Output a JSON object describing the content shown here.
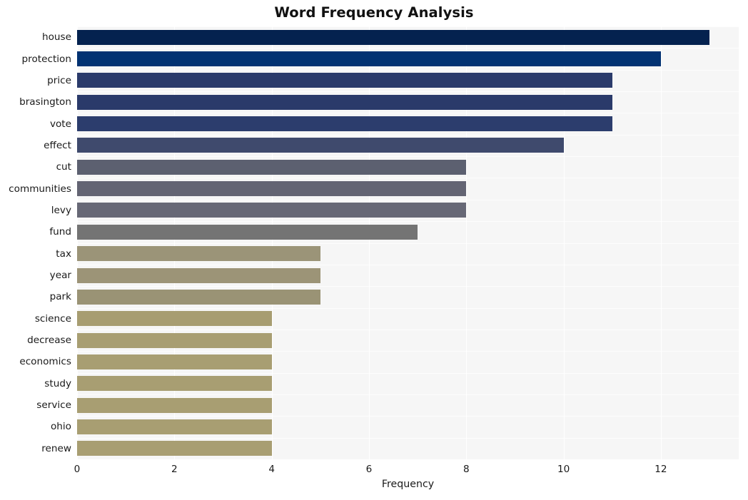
{
  "chart_data": {
    "type": "bar",
    "orientation": "horizontal",
    "title": "Word Frequency Analysis",
    "xlabel": "Frequency",
    "ylabel": "",
    "categories": [
      "house",
      "protection",
      "price",
      "brasington",
      "vote",
      "effect",
      "cut",
      "communities",
      "levy",
      "fund",
      "tax",
      "year",
      "park",
      "science",
      "decrease",
      "economics",
      "study",
      "service",
      "ohio",
      "renew"
    ],
    "values": [
      13,
      12,
      11,
      11,
      11,
      10,
      8,
      8,
      8,
      7,
      5,
      5,
      5,
      4,
      4,
      4,
      4,
      4,
      4,
      4
    ],
    "bar_colors": [
      "#04224f",
      "#023272",
      "#2b3b6b",
      "#2a3a6a",
      "#2c3d6d",
      "#3f4a6d",
      "#5c6070",
      "#636473",
      "#676876",
      "#747474",
      "#9b9478",
      "#9c9477",
      "#9a9375",
      "#a79d71",
      "#a89e72",
      "#a89e72",
      "#a89e72",
      "#a89e72",
      "#a89e72",
      "#a89e72"
    ],
    "xticks": [
      0,
      2,
      4,
      6,
      8,
      10,
      12
    ],
    "xtick_labels": [
      "0",
      "2",
      "4",
      "6",
      "8",
      "10",
      "12"
    ],
    "xlim": [
      0,
      13.6
    ],
    "grid": true,
    "legend": null,
    "plot_background": "#f6f6f6",
    "figure_background": "#ffffff"
  }
}
